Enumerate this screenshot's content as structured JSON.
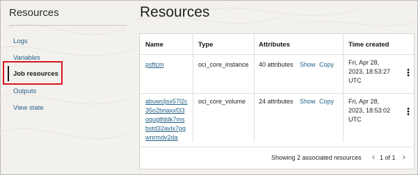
{
  "sidebar": {
    "title": "Resources",
    "items": [
      {
        "label": "Logs"
      },
      {
        "label": "Variables"
      },
      {
        "label": "Job resources"
      },
      {
        "label": "Outputs"
      },
      {
        "label": "View state"
      }
    ]
  },
  "main": {
    "title": "Resources",
    "table": {
      "headers": [
        "Name",
        "Type",
        "Attributes",
        "Time created"
      ],
      "rows": [
        {
          "name_lines": [
            "psftcm"
          ],
          "type": "oci_core_instance",
          "attributes": "40 attributes",
          "show": "Show",
          "copy": "Copy",
          "time_lines": [
            "Fri, Apr 28,",
            "2023, 18:53:27",
            "UTC"
          ]
        },
        {
          "name_lines": [
            "abuwcljsx57l2c",
            "35o2bnaxxf33",
            "oqugtfddk7ms",
            "bstd32avlx7pg",
            "wnrmdv2da"
          ],
          "type": "oci_core_volume",
          "attributes": "24 attributes",
          "show": "Show",
          "copy": "Copy",
          "time_lines": [
            "Fri, Apr 28,",
            "2023, 18:53:02",
            "UTC"
          ]
        }
      ],
      "footer": "Showing 2 associated resources",
      "pager": "1 of 1"
    }
  },
  "colors": {
    "accent": "#d7141a",
    "link": "#1f5e86",
    "background": "#f3f1ee"
  }
}
